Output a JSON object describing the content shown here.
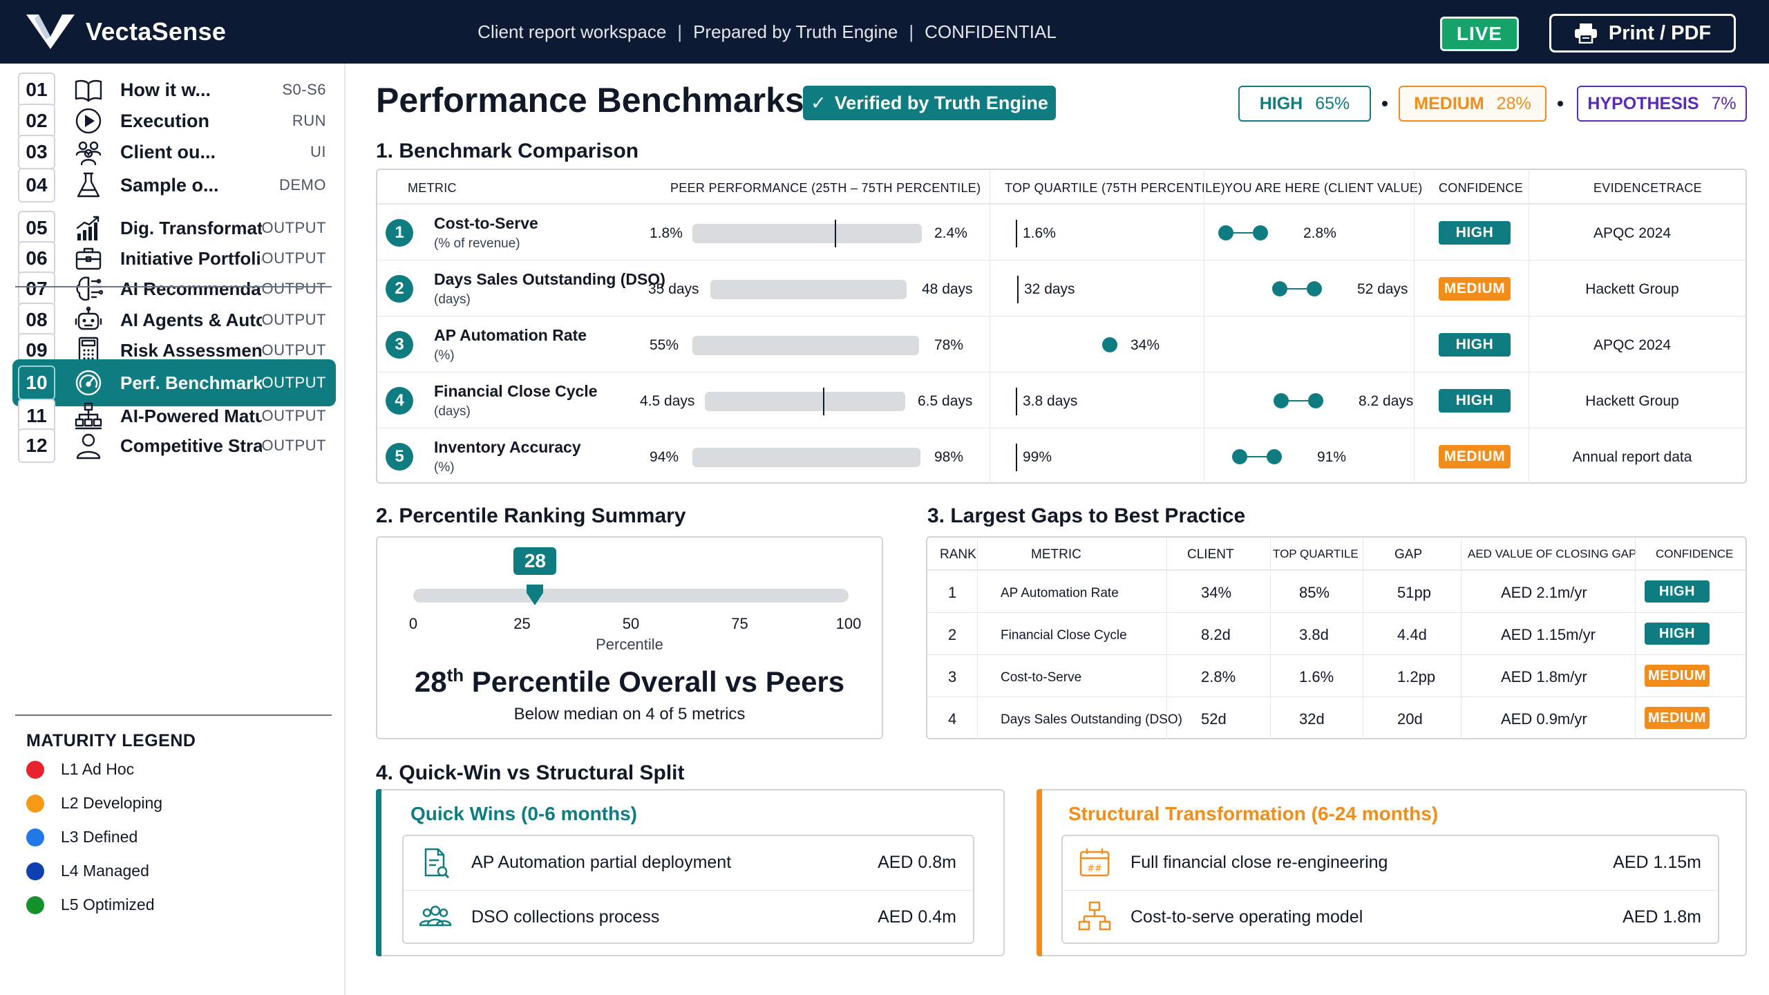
{
  "app": {
    "name": "VectaSense",
    "header_context": [
      "Client report workspace",
      "Prepared by Truth Engine",
      "CONFIDENTIAL"
    ],
    "header_separator": "|",
    "live_label": "LIVE",
    "print_label": "Print / PDF"
  },
  "sidebar": {
    "items": [
      {
        "num": "01",
        "label": "How it w...",
        "tag": "S0-S6",
        "icon": "book-icon"
      },
      {
        "num": "02",
        "label": "Execution",
        "tag": "RUN",
        "icon": "play-icon"
      },
      {
        "num": "03",
        "label": "Client ou...",
        "tag": "UI",
        "icon": "users-icon"
      },
      {
        "num": "04",
        "label": "Sample o...",
        "tag": "DEMO",
        "icon": "flask-icon"
      },
      {
        "num": "05",
        "label": "Dig. Transformation",
        "tag": "OUTPUT",
        "icon": "growth-chart-icon"
      },
      {
        "num": "06",
        "label": "Initiative Portfolio",
        "tag": "OUTPUT",
        "icon": "briefcase-icon"
      },
      {
        "num": "07",
        "label": "AI Recommendations",
        "tag": "OUTPUT",
        "icon": "brain-icon"
      },
      {
        "num": "08",
        "label": "AI Agents & Auto.",
        "tag": "OUTPUT",
        "icon": "robot-icon"
      },
      {
        "num": "09",
        "label": "Risk Assessment",
        "tag": "OUTPUT",
        "icon": "calculator-icon"
      },
      {
        "num": "10",
        "label": "Perf. Benchmarks",
        "tag": "OUTPUT",
        "icon": "gauge-icon",
        "active": true
      },
      {
        "num": "11",
        "label": "AI-Powered Maturity",
        "tag": "OUTPUT",
        "icon": "hierarchy-icon"
      },
      {
        "num": "12",
        "label": "Competitive Strategy",
        "tag": "OUTPUT",
        "icon": "person-icon"
      }
    ],
    "legend": {
      "title": "MATURITY LEGEND",
      "items": [
        {
          "label": "L1 Ad Hoc",
          "color": "#e8232b"
        },
        {
          "label": "L2 Developing",
          "color": "#f59a16"
        },
        {
          "label": "L3 Defined",
          "color": "#1f7ae8"
        },
        {
          "label": "L4 Managed",
          "color": "#0f3fb0"
        },
        {
          "label": "L5 Optimized",
          "color": "#14922c"
        }
      ]
    }
  },
  "page": {
    "title": "Performance Benchmarks",
    "verified_label": "Verified by Truth Engine",
    "confidence_chips": [
      {
        "level": "HIGH",
        "value": "65%",
        "color": "#0f7c82"
      },
      {
        "level": "MEDIUM",
        "value": "28%",
        "color": "#f28c1b"
      },
      {
        "level": "HYPOTHESIS",
        "value": "7%",
        "color": "#5b2bb5"
      }
    ]
  },
  "benchmark": {
    "section_title": "1. Benchmark Comparison",
    "columns": [
      "METRIC",
      "PEER PERFORMANCE (25TH – 75TH PERCENTILE)",
      "TOP QUARTILE (75TH PERCENTILE)",
      "YOU ARE HERE (CLIENT VALUE)",
      "CONFIDENCE",
      "EVIDENCETRACE"
    ],
    "rows": [
      {
        "num": "1",
        "metric": "Cost-to-Serve",
        "unit": "(% of revenue)",
        "p25": "1.8%",
        "p75": "2.4%",
        "median_marker": 0.62,
        "top_quartile": "1.6%",
        "client": "2.8%",
        "confidence": "HIGH",
        "evidence": "APQC 2024"
      },
      {
        "num": "2",
        "metric": "Days Sales Outstanding (DSO)",
        "unit": "(days)",
        "p25": "35 days",
        "p75": "48 days",
        "median_marker": null,
        "top_quartile": "32 days",
        "client": "52 days",
        "confidence": "MEDIUM",
        "evidence": "Hackett Group"
      },
      {
        "num": "3",
        "metric": "AP Automation Rate",
        "unit": "(%)",
        "p25": "55%",
        "p75": "78%",
        "median_marker": null,
        "top_quartile": "",
        "client": "34%",
        "confidence": "HIGH",
        "evidence": "APQC 2024"
      },
      {
        "num": "4",
        "metric": "Financial Close Cycle",
        "unit": "(days)",
        "p25": "4.5 days",
        "p75": "6.5 days",
        "median_marker": 0.59,
        "top_quartile": "3.8 days",
        "client": "8.2 days",
        "confidence": "HIGH",
        "evidence": "Hackett Group"
      },
      {
        "num": "5",
        "metric": "Inventory Accuracy",
        "unit": "(%)",
        "p25": "94%",
        "p75": "98%",
        "median_marker": null,
        "top_quartile": "99%",
        "client": "91%",
        "confidence": "MEDIUM",
        "evidence": "Annual report data"
      }
    ]
  },
  "percentile": {
    "section_title": "2. Percentile Ranking Summary",
    "value": 28,
    "bubble": "28",
    "ticks": [
      "0",
      "25",
      "50",
      "75",
      "100"
    ],
    "axis_label": "Percentile",
    "headline_number": "28",
    "headline_suffix": "th",
    "headline_text": "Percentile Overall vs Peers",
    "subtext": "Below median on 4 of 5 metrics"
  },
  "gaps": {
    "section_title": "3.  Largest Gaps to Best Practice",
    "columns": [
      "RANK",
      "METRIC",
      "CLIENT",
      "TOP QUARTILE",
      "GAP",
      "AED VALUE OF CLOSING GAP",
      "CONFIDENCE"
    ],
    "rows": [
      {
        "rank": "1",
        "metric": "AP Automation Rate",
        "client": "34%",
        "top_quartile": "85%",
        "gap": "51pp",
        "value": "AED 2.1m/yr",
        "confidence": "HIGH"
      },
      {
        "rank": "2",
        "metric": "Financial Close Cycle",
        "client": "8.2d",
        "top_quartile": "3.8d",
        "gap": "4.4d",
        "value": "AED 1.15m/yr",
        "confidence": "HIGH"
      },
      {
        "rank": "3",
        "metric": "Cost-to-Serve",
        "client": "2.8%",
        "top_quartile": "1.6%",
        "gap": "1.2pp",
        "value": "AED 1.8m/yr",
        "confidence": "MEDIUM"
      },
      {
        "rank": "4",
        "metric": "Days Sales Outstanding (DSO)",
        "client": "52d",
        "top_quartile": "32d",
        "gap": "20d",
        "value": "AED 0.9m/yr",
        "confidence": "MEDIUM"
      }
    ]
  },
  "split": {
    "section_title": "4. Quick-Win vs Structural Split",
    "quick": {
      "title": "Quick Wins (0-6 months)",
      "color": "#0f7c82",
      "items": [
        {
          "label": "AP Automation partial deployment",
          "value": "AED 0.8m",
          "icon": "document-search-icon"
        },
        {
          "label": "DSO collections process",
          "value": "AED 0.4m",
          "icon": "team-icon"
        }
      ]
    },
    "structural": {
      "title": "Structural Transformation (6-24 months)",
      "color": "#f28c1b",
      "items": [
        {
          "label": "Full financial close re-engineering",
          "value": "AED 1.15m",
          "icon": "calendar-icon"
        },
        {
          "label": "Cost-to-serve operating model",
          "value": "AED 1.8m",
          "icon": "org-chart-icon"
        }
      ]
    }
  }
}
